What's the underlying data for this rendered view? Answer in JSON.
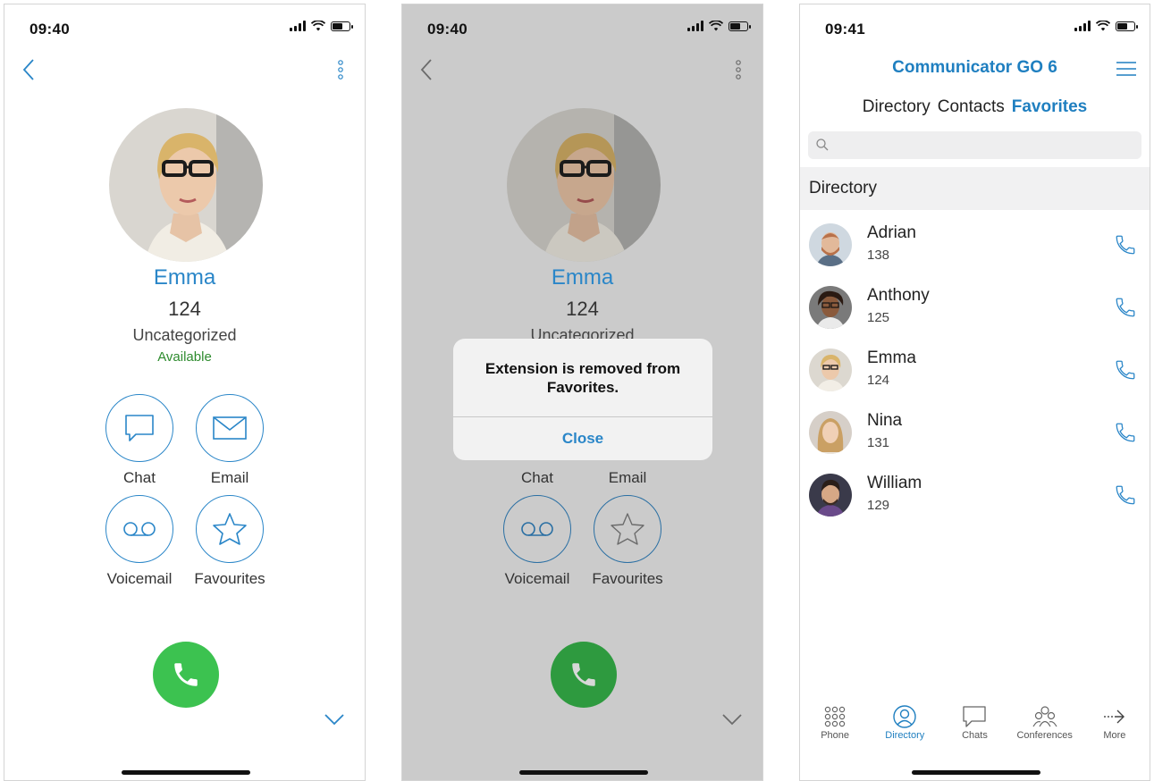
{
  "screens": [
    {
      "time": "09:40",
      "contact": {
        "name": "Emma",
        "extension": "124",
        "category": "Uncategorized",
        "status": "Available"
      },
      "actions": {
        "chat": "Chat",
        "email": "Email",
        "voicemail": "Voicemail",
        "favourites": "Favourites"
      }
    },
    {
      "time": "09:40",
      "contact": {
        "name": "Emma",
        "extension": "124",
        "category": "Uncategorized"
      },
      "actions": {
        "chat": "Chat",
        "email": "Email",
        "voicemail": "Voicemail",
        "favourites": "Favourites"
      },
      "alert": {
        "message": "Extension is removed from Favorites.",
        "button": "Close"
      }
    },
    {
      "time": "09:41",
      "app_title": "Communicator GO 6",
      "tabs": [
        "Directory",
        "Contacts",
        "Favorites"
      ],
      "active_tab": "Favorites",
      "section_header": "Directory",
      "contacts": [
        {
          "name": "Adrian",
          "extension": "138"
        },
        {
          "name": "Anthony",
          "extension": "125"
        },
        {
          "name": "Emma",
          "extension": "124"
        },
        {
          "name": "Nina",
          "extension": "131"
        },
        {
          "name": "William",
          "extension": "129"
        }
      ],
      "tabbar": [
        "Phone",
        "Directory",
        "Chats",
        "Conferences",
        "More"
      ],
      "tabbar_active": "Directory"
    }
  ],
  "colors": {
    "accent": "#2a86c8",
    "available": "#2e8b2e",
    "call": "#3cc250"
  }
}
